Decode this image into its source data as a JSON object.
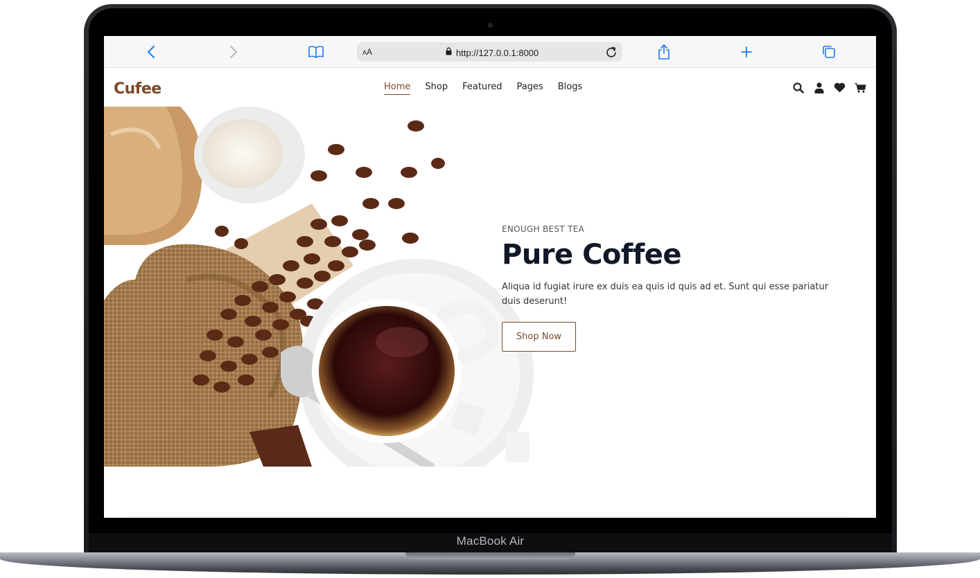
{
  "device": {
    "model_label": "MacBook Air"
  },
  "browser": {
    "url": "http://127.0.0.1:8000",
    "text_size_label_small": "A",
    "text_size_label_large": "A",
    "icons": [
      "back-icon",
      "forward-icon",
      "bookmarks-icon",
      "lock-icon",
      "reload-icon",
      "share-icon",
      "new-tab-icon",
      "tabs-icon"
    ]
  },
  "site": {
    "logo": "Cufee",
    "nav": [
      {
        "label": "Home",
        "active": true
      },
      {
        "label": "Shop",
        "active": false
      },
      {
        "label": "Featured",
        "active": false
      },
      {
        "label": "Pages",
        "active": false
      },
      {
        "label": "Blogs",
        "active": false
      }
    ],
    "header_icons": [
      "search-icon",
      "user-icon",
      "heart-icon",
      "cart-icon"
    ]
  },
  "hero": {
    "eyebrow": "ENOUGH BEST TEA",
    "title": "Pure Coffee",
    "description": "Aliqua id fugiat irure ex duis ea quis id quis ad et. Sunt qui esse pariatur duis deserunt!",
    "cta_label": "Shop Now"
  },
  "colors": {
    "brand": "#7a4a2b",
    "title": "#111827",
    "ios_blue": "#1a7cf2"
  }
}
